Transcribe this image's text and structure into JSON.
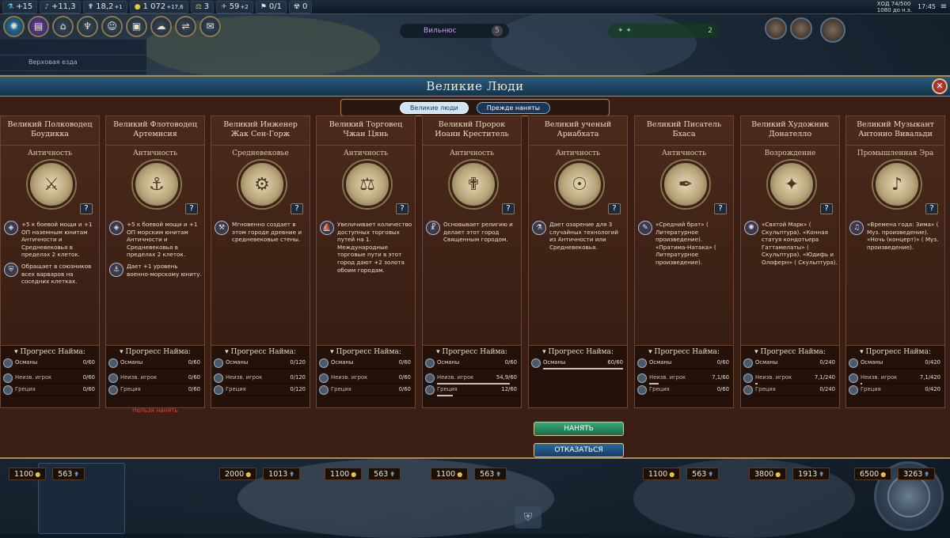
{
  "topbar": {
    "science": "+15",
    "culture": "+11,3",
    "faith": "18,2",
    "faith_delta": "+1",
    "gold": "1 072",
    "gold_delta": "+17,6",
    "trade": "3",
    "tourism": "59",
    "tourism_delta": "+2",
    "envoy": "0/1",
    "alerts": "0",
    "turn": "ХОД 74/500",
    "date": "1080 до н.э.",
    "clock": "17:45"
  },
  "map": {
    "city1_name": "Вильнюс",
    "city1_size": "5",
    "city2_size": "2",
    "leftpanel_row": "Верховая езда"
  },
  "dialog": {
    "title": "Великие Люди",
    "close_icon": "close-icon",
    "tab_active": "Великие люди",
    "tab_previous": "Прежде наняты"
  },
  "progress_header": "Прогресс Найма:",
  "cant_hire": "Нельзя нанять",
  "hire_label": "НАНЯТЬ",
  "reject_label": "ОТКАЗАТЬСЯ",
  "help_label": "?",
  "cards": [
    {
      "cls": "Великий Полководец",
      "name": "Боудикка",
      "era": "Античность",
      "abilities": [
        {
          "icon": "◈",
          "text": "+5 к боевой мощи и +1 ОП наземным юнитам Античности и Средневековья в пределах 2 клеток."
        },
        {
          "icon": "⛨",
          "text": "Обращает в союзников всех варваров на соседних клетках."
        }
      ],
      "progress": [
        {
          "name": "Османы",
          "value": "0/60",
          "pct": 0,
          "sub": false
        },
        {
          "name": "Неизв. игрок",
          "value": "0/60",
          "pct": 0,
          "sub": true
        },
        {
          "name": "Греция",
          "value": "0/60",
          "pct": 0,
          "sub": true
        }
      ],
      "gold": "1100",
      "faith": "563",
      "state": "none"
    },
    {
      "cls": "Великий Флотоводец",
      "name": "Артемисия",
      "era": "Античность",
      "abilities": [
        {
          "icon": "◈",
          "text": "+5 к боевой мощи и +1 ОП морским юнитам Античности и Средневековья в пределах 2 клеток."
        },
        {
          "icon": "⚓",
          "text": "Дает +1 уровень военно-морскому юниту."
        }
      ],
      "progress": [
        {
          "name": "Османы",
          "value": "0/60",
          "pct": 0,
          "sub": false
        },
        {
          "name": "Неизв. игрок",
          "value": "0/60",
          "pct": 0,
          "sub": true
        },
        {
          "name": "Греция",
          "value": "0/60",
          "pct": 0,
          "sub": true
        }
      ],
      "gold": "",
      "faith": "",
      "state": "cant"
    },
    {
      "cls": "Великий Инженер",
      "name": "Жак Сен-Горж",
      "era": "Средневековье",
      "abilities": [
        {
          "icon": "⚒",
          "text": "Мгновенно создает в этом городе древние и средневековые стены."
        }
      ],
      "progress": [
        {
          "name": "Османы",
          "value": "0/120",
          "pct": 0,
          "sub": false
        },
        {
          "name": "Неизв. игрок",
          "value": "0/120",
          "pct": 0,
          "sub": true
        },
        {
          "name": "Греция",
          "value": "0/120",
          "pct": 0,
          "sub": true
        }
      ],
      "gold": "2000",
      "faith": "1013",
      "state": "none"
    },
    {
      "cls": "Великий Торговец",
      "name": "Чжан Цянь",
      "era": "Античность",
      "abilities": [
        {
          "icon": "⛵",
          "text": "Увеличивает количество доступных торговых путей на 1. Международные торговые пути в этот город дают +2 золота обоим городам."
        }
      ],
      "progress": [
        {
          "name": "Османы",
          "value": "0/60",
          "pct": 0,
          "sub": false
        },
        {
          "name": "Неизв. игрок",
          "value": "0/60",
          "pct": 0,
          "sub": true
        },
        {
          "name": "Греция",
          "value": "0/60",
          "pct": 0,
          "sub": true
        }
      ],
      "gold": "1100",
      "faith": "563",
      "state": "none"
    },
    {
      "cls": "Великий Пророк",
      "name": "Иоанн Креститель",
      "era": "Античность",
      "abilities": [
        {
          "icon": "☧",
          "text": "Основывает религию и делает этот город Священным городом."
        }
      ],
      "progress": [
        {
          "name": "Османы",
          "value": "0/60",
          "pct": 0,
          "sub": false
        },
        {
          "name": "Неизв. игрок",
          "value": "54,9/60",
          "pct": 91,
          "sub": true
        },
        {
          "name": "Греция",
          "value": "12/60",
          "pct": 20,
          "sub": true
        }
      ],
      "gold": "1100",
      "faith": "563",
      "state": "none"
    },
    {
      "cls": "Великий ученый",
      "name": "Ариабхата",
      "era": "Античность",
      "abilities": [
        {
          "icon": "⚗",
          "text": "Дает озарение для 3 случайных технологий из Античности или Средневековья."
        }
      ],
      "progress": [
        {
          "name": "Османы",
          "value": "60/60",
          "pct": 100,
          "sub": false
        }
      ],
      "gold": "",
      "faith": "",
      "state": "hire"
    },
    {
      "cls": "Великий Писатель",
      "name": "Бхаса",
      "era": "Античность",
      "abilities": [
        {
          "icon": "✎",
          "text": "«Средний брат» ( Литературное произведение). «Пратима-Натака» ( Литературное произведение)."
        }
      ],
      "progress": [
        {
          "name": "Османы",
          "value": "0/60",
          "pct": 0,
          "sub": false
        },
        {
          "name": "Неизв. игрок",
          "value": "7,1/60",
          "pct": 12,
          "sub": true
        },
        {
          "name": "Греция",
          "value": "0/60",
          "pct": 0,
          "sub": true
        }
      ],
      "gold": "1100",
      "faith": "563",
      "state": "none"
    },
    {
      "cls": "Великий Художник",
      "name": "Донателло",
      "era": "Возрождение",
      "abilities": [
        {
          "icon": "✺",
          "text": "«Святой Марк» ( Скульптура). «Конная статуя кондотьера Гаттамелаты» ( Скульптура). «Юдифь и Олоферн» ( Скульптура)."
        }
      ],
      "progress": [
        {
          "name": "Османы",
          "value": "0/240",
          "pct": 0,
          "sub": false
        },
        {
          "name": "Неизв. игрок",
          "value": "7,1/240",
          "pct": 3,
          "sub": true
        },
        {
          "name": "Греция",
          "value": "0/240",
          "pct": 0,
          "sub": true
        }
      ],
      "gold": "3800",
      "faith": "1913",
      "state": "none"
    },
    {
      "cls": "Великий Музыкант",
      "name": "Антонио Вивальди",
      "era": "Промышленная Эра",
      "abilities": [
        {
          "icon": "♫",
          "text": "«Времена года: Зима» ( Муз. произведение). «Ночь (концерт)» ( Муз. произведение)."
        }
      ],
      "progress": [
        {
          "name": "Османы",
          "value": "0/420",
          "pct": 0,
          "sub": false
        },
        {
          "name": "Неизв. игрок",
          "value": "7,1/420",
          "pct": 2,
          "sub": true
        },
        {
          "name": "Греция",
          "value": "0/420",
          "pct": 0,
          "sub": true
        }
      ],
      "gold": "6500",
      "faith": "3263",
      "state": "none"
    }
  ],
  "medal_icons": [
    "⚔",
    "⚓",
    "⚙",
    "⚖",
    "✟",
    "☉",
    "✒",
    "✦",
    "♪"
  ]
}
